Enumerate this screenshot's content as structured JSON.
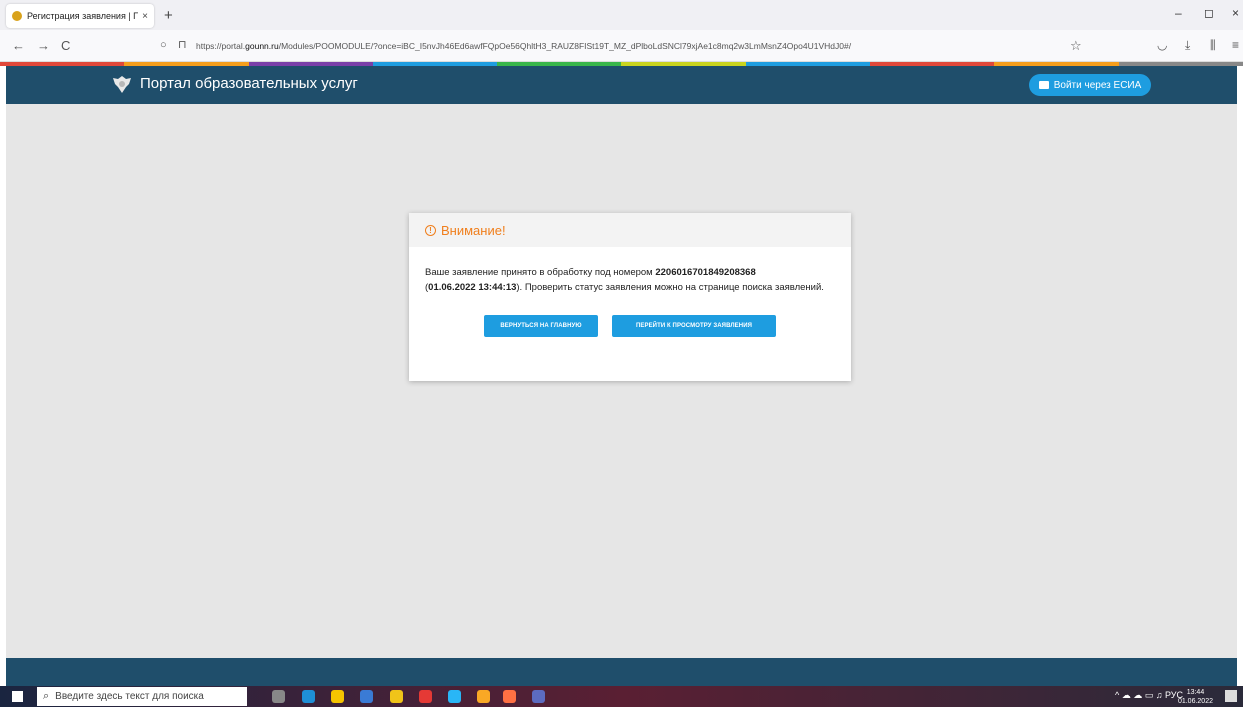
{
  "browser": {
    "tab_title": "Регистрация заявления | Порт",
    "tab_close": "×",
    "new_tab": "+",
    "minimize": "–",
    "restore": "◻",
    "close": "×",
    "back": "←",
    "forward": "→",
    "reload": "C",
    "url_prefix": "https://portal.",
    "url_host": "gounn.ru",
    "url_rest": "/Modules/POOMODULE/?once=iBC_I5nvJh46Ed6awfFQpOe56QhltH3_RAUZ8FISt19T_MZ_dPlboLdSNCl79xjAe1c8mq2w3LmMsnZ4Opo4U1VHdJ0#/"
  },
  "portal": {
    "title": "Портал образовательных услуг",
    "login_button": "Войти через ЕСИА"
  },
  "dialog": {
    "heading": "Внимание!",
    "text_1": "Ваше заявление принято в обработку под номером ",
    "application_number": "2206016701849208368",
    "text_2": "(",
    "date": "01.06.2022 13:44:13",
    "text_3": "). Проверить статус заявления можно на странице поиска заявлений.",
    "button_home": "ВЕРНУТЬСЯ НА ГЛАВНУЮ",
    "button_view": "ПЕРЕЙТИ К ПРОСМОТРУ ЗАЯВЛЕНИЯ"
  },
  "taskbar": {
    "search_placeholder": "Введите здесь текст для поиска",
    "language": "РУС",
    "time": "13:44",
    "date": "01.06.2022"
  },
  "colors": {
    "header": "#1f4e6b",
    "accent": "#1e9de0",
    "warning": "#f07f1d",
    "strip": [
      "#e0483a",
      "#f59e1c",
      "#7a3fa8",
      "#1e9de0",
      "#39b54a",
      "#c9d41f",
      "#1e9de0",
      "#e0483a",
      "#f59e1c",
      "#888888"
    ]
  }
}
